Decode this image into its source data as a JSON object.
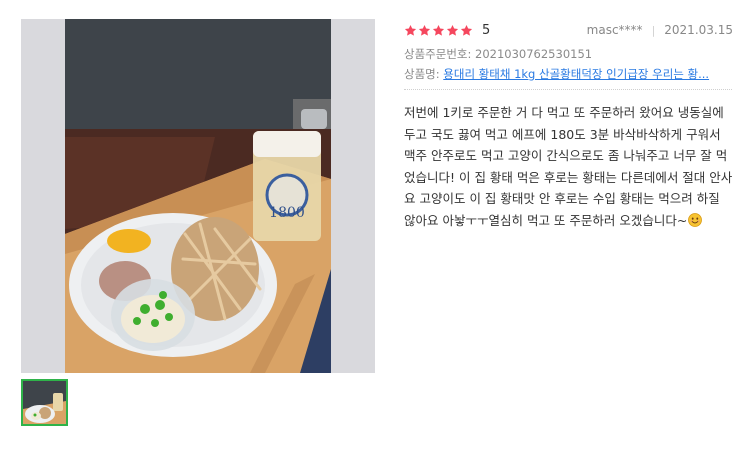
{
  "review": {
    "stars": 5,
    "score_label": "5",
    "author": "masc****",
    "date": "2021.03.15",
    "order_no_label": "상품주문번호: ",
    "order_no": "2021030762530151",
    "product_label": "상품명: ",
    "product_name": "용대리 황태채 1kg 산골황태덕장 인기급장 우리는 황...",
    "body": "저번에 1키로 주문한 거 다 먹고 또 주문하러 왔어요 냉동실에 두고 국도 끓여 먹고 에프에 180도 3분 바삭바삭하게 구워서 맥주 안주로도 먹고 고양이 간식으로도 좀 나눠주고 너무 잘 먹었습니다! 이 집 황태 먹은 후로는 황태는 다른데에서 절대 안사요 고양이도 이 집 황태맛 안 후로는 수입 황태는 먹으려 하질 않아요 아놯ㅜㅜ열심히 먹고 또 주문하러 오겠습니다~",
    "emoji_icon": "smiling-face-icon"
  },
  "photo": {
    "subject_icon": "food-photo-icon",
    "glass_logo": "1800",
    "thumbnail_icon": "food-photo-thumbnail-icon"
  },
  "colors": {
    "star": "#f5475e",
    "link": "#2a7ae2",
    "thumb_border": "#2fb34a"
  }
}
